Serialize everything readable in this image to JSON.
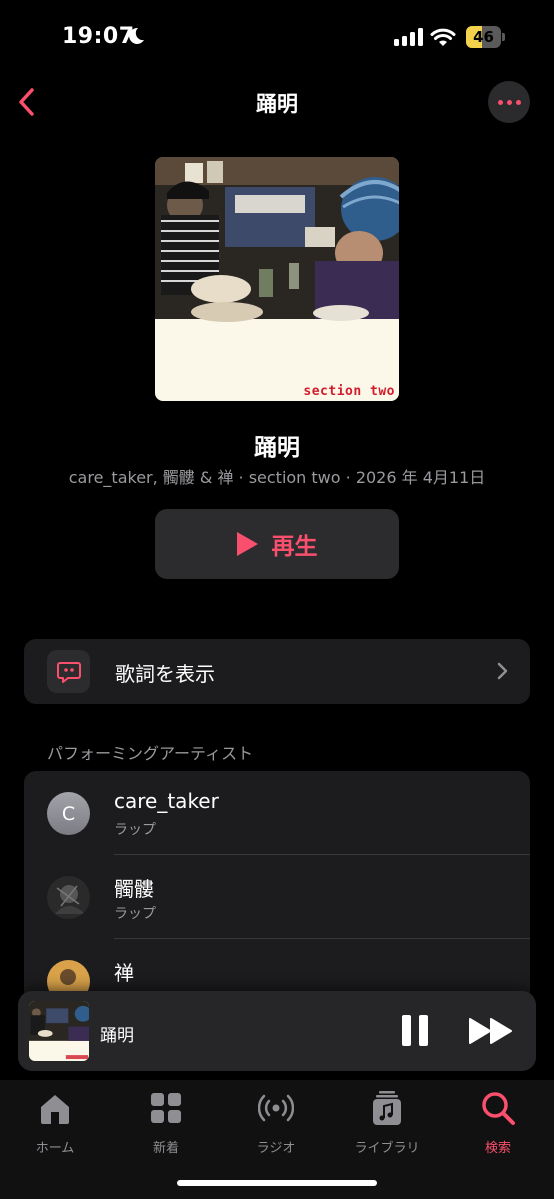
{
  "status": {
    "time": "19:07",
    "battery": "46",
    "battery_level": 0.46
  },
  "nav": {
    "title": "踊明",
    "back_icon": "chevron-left-icon",
    "more_icon": "ellipsis-icon"
  },
  "album": {
    "art_label": "section two"
  },
  "song": {
    "title": "踊明",
    "meta": "care_taker, 髑髏 & 禅 · section two · 2026 年 4月11日"
  },
  "play_label": "再生",
  "lyrics": {
    "label": "歌詞を表示",
    "icon": "lyrics-quote-icon"
  },
  "artists": {
    "header": "パフォーミングアーティスト",
    "items": [
      {
        "initial": "C",
        "name": "care_taker",
        "role": "ラップ"
      },
      {
        "name": "髑髏",
        "role": "ラップ"
      },
      {
        "name": "禅",
        "role": ""
      }
    ]
  },
  "now_playing": {
    "title": "踊明"
  },
  "tabs": [
    {
      "label": "ホーム",
      "icon": "home-icon"
    },
    {
      "label": "新着",
      "icon": "grid-icon"
    },
    {
      "label": "ラジオ",
      "icon": "radio-icon"
    },
    {
      "label": "ライブラリ",
      "icon": "library-icon"
    },
    {
      "label": "検索",
      "icon": "search-icon",
      "active": true
    }
  ],
  "colors": {
    "accent": "#fa4f6d",
    "background": "#000000",
    "card": "#1c1c1e"
  }
}
